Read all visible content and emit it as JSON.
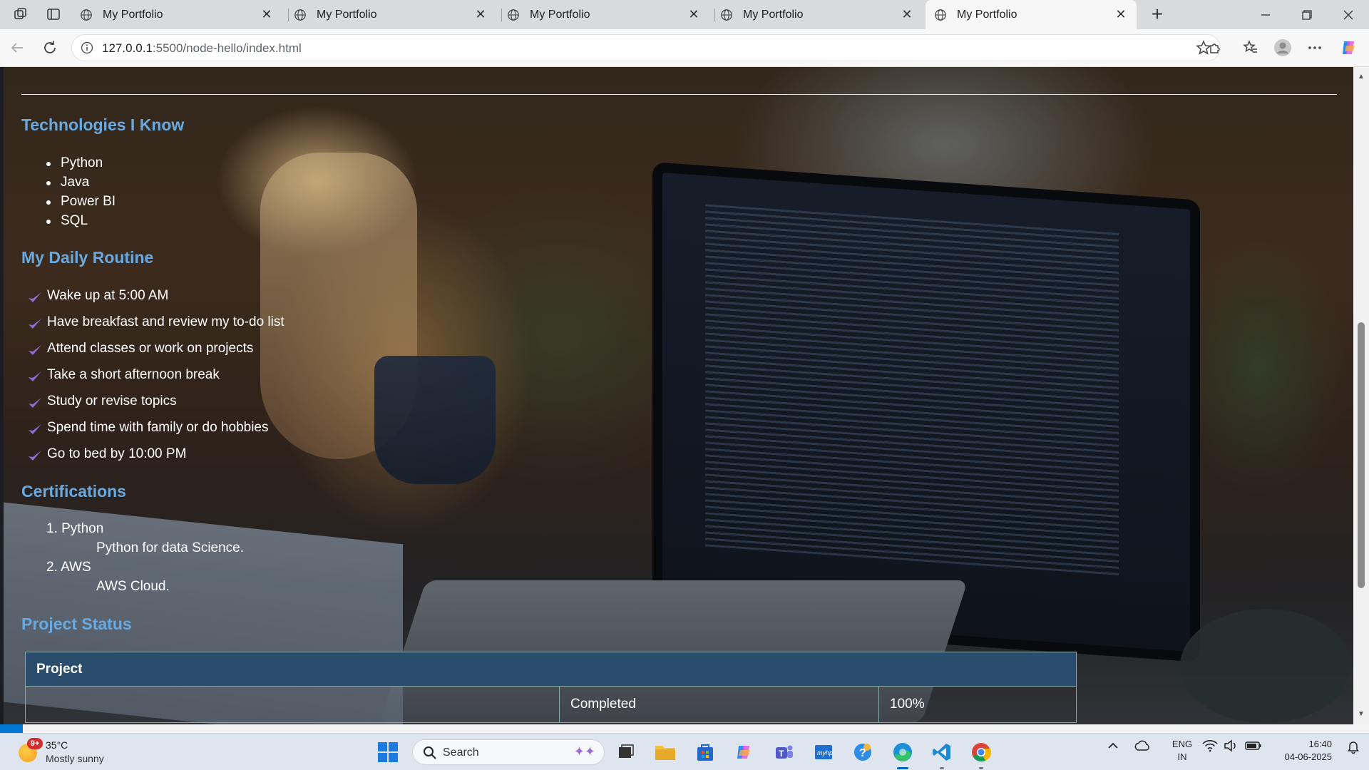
{
  "browser": {
    "tabs": [
      {
        "title": "My Portfolio",
        "active": false
      },
      {
        "title": "My Portfolio",
        "active": false
      },
      {
        "title": "My Portfolio",
        "active": false
      },
      {
        "title": "My Portfolio",
        "active": false
      },
      {
        "title": "My Portfolio",
        "active": true
      }
    ],
    "url_host": "127.0.0.1",
    "url_path": ":5500/node-hello/index.html"
  },
  "page": {
    "technologies": {
      "heading": "Technologies I Know",
      "items": [
        "Python",
        "Java",
        "Power BI",
        "SQL"
      ]
    },
    "routine": {
      "heading": "My Daily Routine",
      "items": [
        "Wake up at 5:00 AM",
        "Have breakfast and review my to-do list",
        "Attend classes or work on projects",
        "Take a short afternoon break",
        "Study or revise topics",
        "Spend time with family or do hobbies",
        "Go to bed by 10:00 PM"
      ]
    },
    "certifications": {
      "heading": "Certifications",
      "items": [
        {
          "name": "1. Python",
          "desc": "Python for data Science."
        },
        {
          "name": "2. AWS",
          "desc": "AWS Cloud."
        }
      ]
    },
    "project_status": {
      "heading": "Project Status",
      "header": "Project",
      "row": {
        "project": "",
        "status": "Completed",
        "progress": "100%"
      }
    }
  },
  "taskbar": {
    "weather_badge": "9+",
    "temperature": "35°C",
    "condition": "Mostly sunny",
    "search_label": "Search",
    "lang_line1": "ENG",
    "lang_line2": "IN",
    "time": "16:40",
    "date": "04-06-2025"
  },
  "colors": {
    "heading_blue": "#6aa9e0",
    "table_header": "#2a4d6e",
    "check_purple": "#8b6fd6",
    "edge_blue": "#0067c0"
  }
}
